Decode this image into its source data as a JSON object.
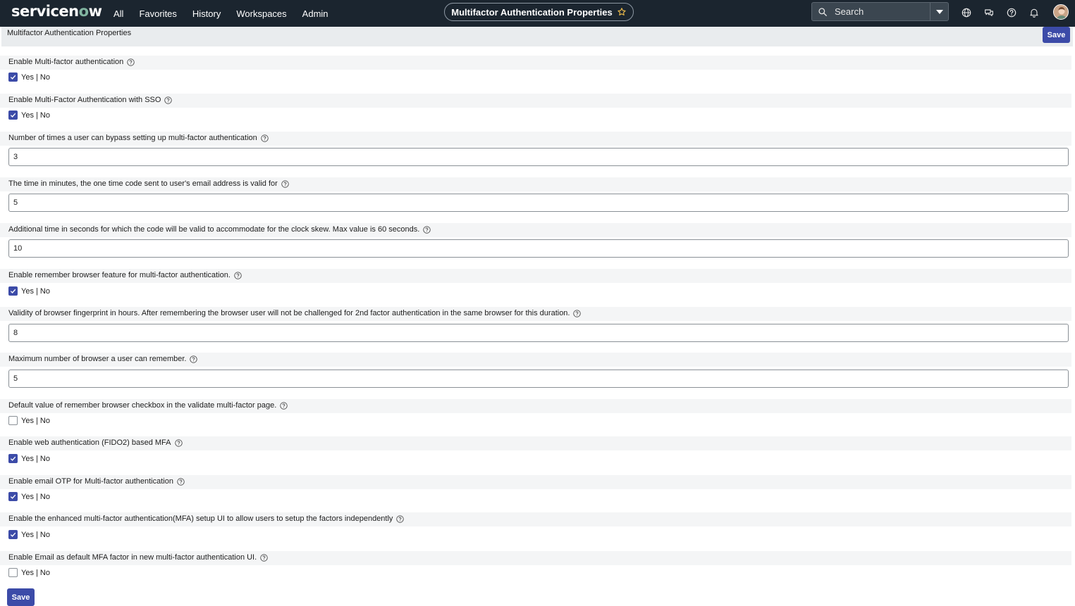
{
  "brand": {
    "logo_text_main": "servicen",
    "logo_text_accent": "o",
    "logo_text_end": "w"
  },
  "nav": {
    "items": [
      "All",
      "Favorites",
      "History",
      "Workspaces",
      "Admin"
    ]
  },
  "context": {
    "title": "Multifactor Authentication Properties"
  },
  "search": {
    "placeholder": "Search"
  },
  "page": {
    "title": "Multifactor Authentication Properties",
    "save_label": "Save"
  },
  "colors": {
    "nav_bg": "#1b252f",
    "accent": "#3c4ba8",
    "logo_accent": "#81b5a1"
  },
  "properties": [
    {
      "type": "checkbox",
      "label": "Enable Multi-factor authentication",
      "checked": true,
      "option_text": "Yes | No"
    },
    {
      "type": "checkbox",
      "label": "Enable Multi-Factor Authentication with SSO",
      "checked": true,
      "option_text": "Yes | No"
    },
    {
      "type": "text",
      "label": "Number of times a user can bypass setting up multi-factor authentication",
      "value": "3"
    },
    {
      "type": "text",
      "label": "The time in minutes, the one time code sent to user's email address is valid for",
      "value": "5"
    },
    {
      "type": "text",
      "label": "Additional time in seconds for which the code will be valid to accommodate for the clock skew. Max value is 60 seconds.",
      "value": "10"
    },
    {
      "type": "checkbox",
      "label": "Enable remember browser feature for multi-factor authentication.",
      "checked": true,
      "option_text": "Yes | No"
    },
    {
      "type": "text",
      "label": "Validity of browser fingerprint in hours. After remembering the browser user will not be challenged for 2nd factor authentication in the same browser for this duration.",
      "value": "8"
    },
    {
      "type": "text",
      "label": "Maximum number of browser a user can remember.",
      "value": "5"
    },
    {
      "type": "checkbox",
      "label": "Default value of remember browser checkbox in the validate multi-factor page.",
      "checked": false,
      "option_text": "Yes | No"
    },
    {
      "type": "checkbox",
      "label": "Enable web authentication (FIDO2) based MFA",
      "checked": true,
      "option_text": "Yes | No"
    },
    {
      "type": "checkbox",
      "label": "Enable email OTP for Multi-factor authentication",
      "checked": true,
      "option_text": "Yes | No"
    },
    {
      "type": "checkbox",
      "label": "Enable the enhanced multi-factor authentication(MFA) setup UI to allow users to setup the factors independently",
      "checked": true,
      "option_text": "Yes | No"
    },
    {
      "type": "checkbox",
      "label": "Enable Email as default MFA factor in new multi-factor authentication UI.",
      "checked": false,
      "option_text": "Yes | No"
    }
  ]
}
